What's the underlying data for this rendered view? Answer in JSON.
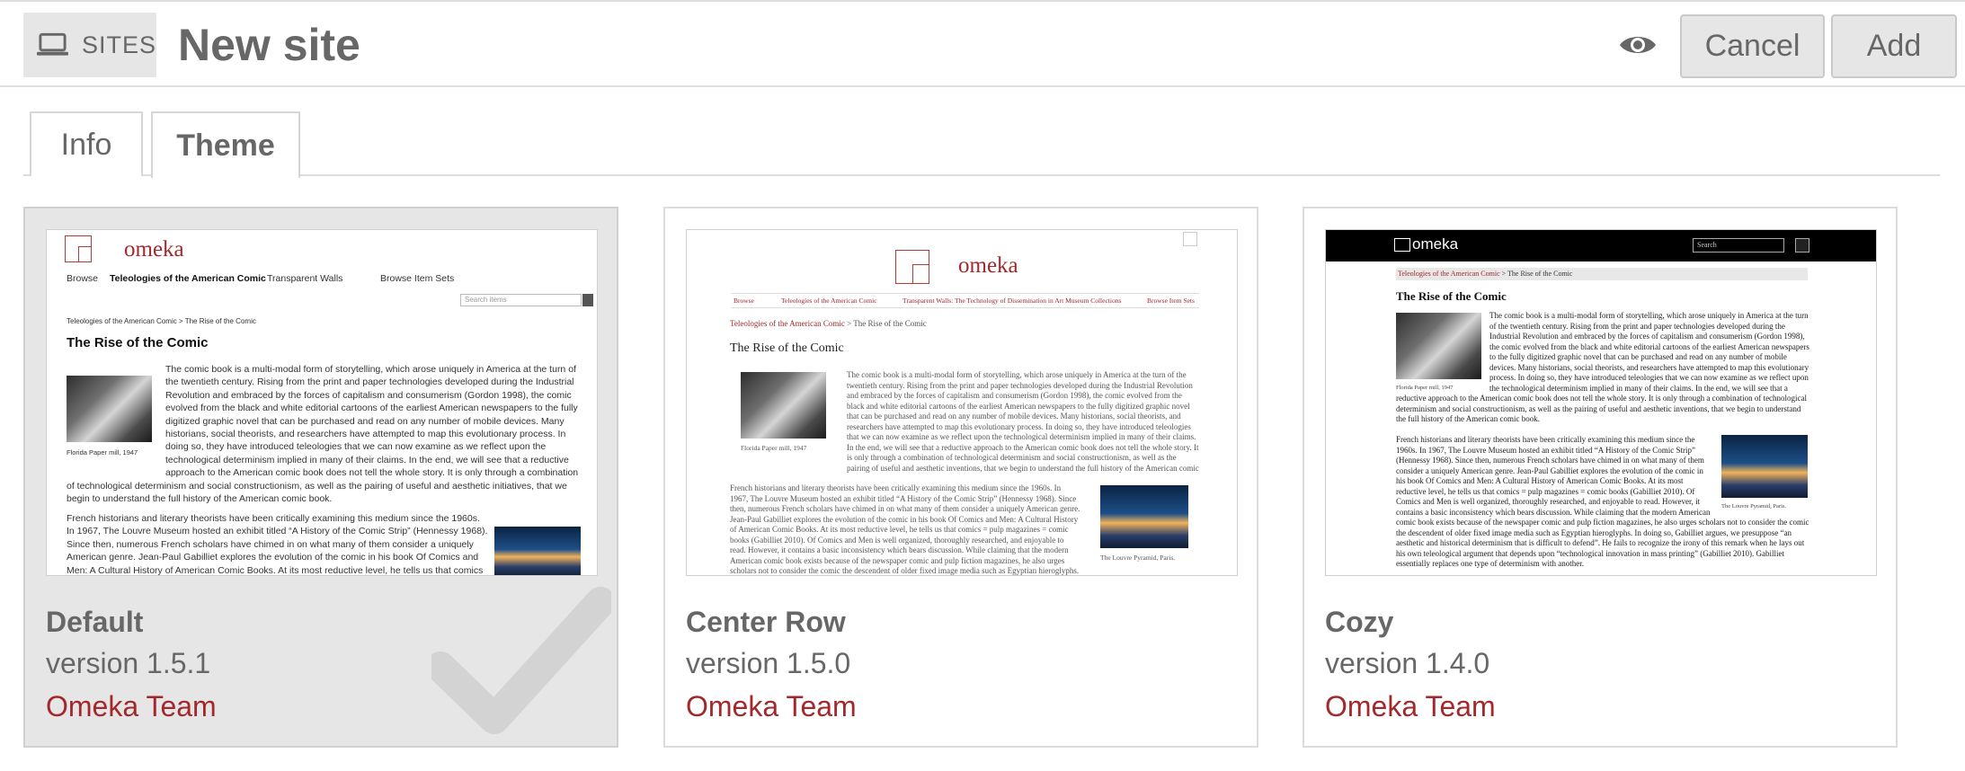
{
  "header": {
    "breadcrumb_label": "SITES",
    "breadcrumb_icon": "laptop-icon",
    "title": "New site",
    "preview_icon": "eye-icon",
    "cancel_label": "Cancel",
    "add_label": "Add"
  },
  "tabs": [
    {
      "label": "Info",
      "active": false
    },
    {
      "label": "Theme",
      "active": true
    }
  ],
  "colors": {
    "accent": "#a3282b",
    "text": "#676767",
    "selected_bg": "#e6e6e6"
  },
  "themes": [
    {
      "name": "Default",
      "version": "version 1.5.1",
      "author": "Omeka Team",
      "selected": true,
      "preview": {
        "logo": "omeka",
        "nav": [
          "Browse",
          "Teleologies of the American Comic",
          "Transparent Walls",
          "Browse Item Sets"
        ],
        "search_placeholder": "Search items",
        "breadcrumb": "Teleologies of the American Comic > The Rise of the Comic",
        "heading": "The Rise of the Comic",
        "image_caption": "Florida Paper mill, 1947",
        "para1": "The comic book is a multi-modal form of storytelling, which arose uniquely in America at the turn of the twentieth century. Rising from the print and paper technologies developed during the Industrial Revolution and embraced by the forces of capitalism and consumerism (Gordon 1998), the comic evolved from the black and white editorial cartoons of the earliest American newspapers to the fully digitized graphic novel that can be purchased and read on any number of mobile devices. Many historians, social theorists, and researchers have attempted to map this evolutionary process. In doing so, they have introduced teleologies that we can now examine as we reflect upon the technological determinism implied in many of their claims. In the end, we will see that a reductive approach to the American comic book does not tell the whole story. It is only through a combination of technological determinism and social constructionism, as well as the pairing of useful and aesthetic initiatives, that we begin to understand the full history of the American comic book.",
        "para2": "French historians and literary theorists have been critically examining this medium since the 1960s. In 1967, The Louvre Museum hosted an exhibit titled “A History of the Comic Strip” (Hennessy 1968). Since then, numerous French scholars have chimed in on what many of them consider a uniquely American genre. Jean-Paul Gabilliet explores the evolution of the comic in his book Of Comics and Men: A Cultural History of American Comic Books. At its most reductive level, he tells us that comics = pulp magazines ="
      }
    },
    {
      "name": "Center Row",
      "version": "version 1.5.0",
      "author": "Omeka Team",
      "selected": false,
      "preview": {
        "logo": "omeka",
        "nav": [
          "Browse",
          "Teleologies of the American Comic",
          "Transparent Walls: The Technology of Dissemination in Art Museum Collections",
          "Browse Item Sets"
        ],
        "breadcrumb_link": "Teleologies of the American Comic",
        "breadcrumb_rest": " > The Rise of the Comic",
        "heading": "The Rise of the Comic",
        "image_caption": "Florida Paper mill, 1947",
        "louvre_caption": "The Louvre Pyramid, Paris.",
        "para1": "The comic book is a multi-modal form of storytelling, which arose uniquely in America at the turn of the twentieth century. Rising from the print and paper technologies developed during the Industrial Revolution and embraced by the forces of capitalism and consumerism (Gordon 1998), the comic evolved from the black and white editorial cartoons of the earliest American newspapers to the fully digitized graphic novel that can be purchased and read on any number of mobile devices. Many historians, social theorists, and researchers have attempted to map this evolutionary process. In doing so, they have introduced teleologies that we can now examine as we reflect upon the technological determinism implied in many of their claims. In the end, we will see that a reductive approach to the American comic book does not tell the whole story. It is only through a combination of technological determinism and social constructionism, as well as the pairing of useful and aesthetic inventions, that we begin to understand the full history of the American comic book.",
        "para2": "French historians and literary theorists have been critically examining this medium since the 1960s. In 1967, The Louvre Museum hosted an exhibit titled “A History of the Comic Strip” (Hennessy 1968). Since then, numerous French scholars have chimed in on what many of them consider a uniquely American genre. Jean-Paul Gabilliet explores the evolution of the comic in his book Of Comics and Men: A Cultural History of American Comic Books. At its most reductive level, he tells us that comics = pulp magazines = comic books (Gabilliet 2010). Of Comics and Men is well organized, thoroughly researched, and enjoyable to read. However, it contains a basic inconsistency which bears discussion. While claiming that the modern American comic book exists because of the newspaper comic and pulp fiction magazines, he also urges scholars not to consider the comic the descendent of older fixed image media such as Egyptian hieroglyphs."
      }
    },
    {
      "name": "Cozy",
      "version": "version 1.4.0",
      "author": "Omeka Team",
      "selected": false,
      "preview": {
        "logo": "omeka",
        "search_placeholder": "Search",
        "breadcrumb_link": "Teleologies of the American Comic",
        "breadcrumb_rest": " > The Rise of the Comic",
        "heading": "The Rise of the Comic",
        "image_caption": "Florida Paper mill, 1947",
        "louvre_caption": "The Louvre Pyramid, Paris.",
        "para1": "The comic book is a multi-modal form of storytelling, which arose uniquely in America at the turn of the twentieth century. Rising from the print and paper technologies developed during the Industrial Revolution and embraced by the forces of capitalism and consumerism (Gordon 1998), the comic evolved from the black and white editorial cartoons of the earliest American newspapers to the fully digitized graphic novel that can be purchased and read on any number of mobile devices. Many historians, social theorists, and researchers have attempted to map this evolutionary process. In doing so, they have introduced teleologies that we can now examine as we reflect upon the technological determinism implied in many of their claims. In the end, we will see that a reductive approach to the American comic book does not tell the whole story. It is only through a combination of technological determinism and social constructionism, as well as the pairing of useful and aesthetic inventions, that we begin to understand the full history of the American comic book.",
        "para2": "French historians and literary theorists have been critically examining this medium since the 1960s. In 1967, The Louvre Museum hosted an exhibit titled “A History of the Comic Strip” (Hennessy 1968). Since then, numerous French scholars have chimed in on what many of them consider a uniquely American genre. Jean-Paul Gabilliet explores the evolution of the comic in his book Of Comics and Men: A Cultural History of American Comic Books. At its most reductive level, he tells us that comics = pulp magazines = comic books (Gabilliet 2010). Of Comics and Men is well organized, thoroughly researched, and enjoyable to read. However, it contains a basic inconsistency which bears discussion. While claiming that the modern American comic book exists because of the newspaper comic and pulp fiction magazines, he also urges scholars not to consider the comic the descendent of older fixed image media such as Egyptian hieroglyphs. In doing so, Gabilliet argues, we presuppose “an aesthetic and historical determinism that is difficult to defend”. He fails to recognize the irony of this remark when he lays out his own teleological argument that depends upon “technological innovation in mass printing” (Gabilliet 2010). Gabilliet essentially replaces one type of determinism with another."
      }
    }
  ]
}
